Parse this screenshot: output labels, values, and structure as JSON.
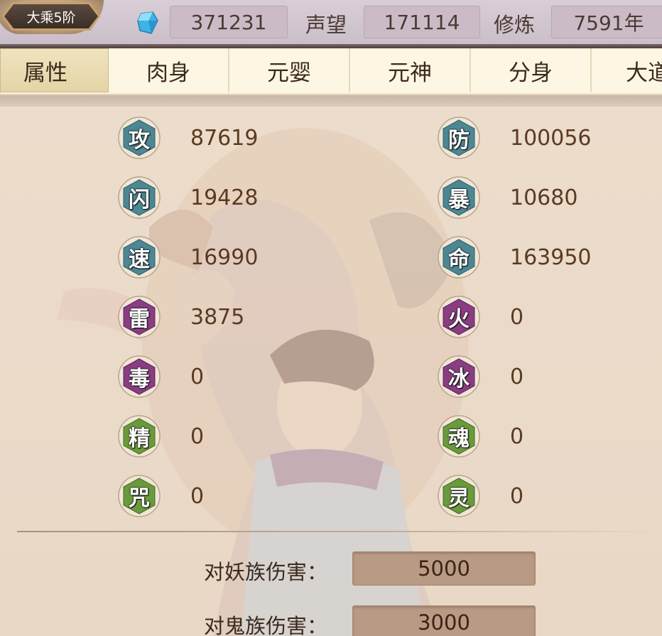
{
  "header": {
    "rank": "大乘5阶",
    "gem_icon": "blue-gem-icon",
    "gem_value": "371231",
    "prestige_label": "声望",
    "prestige_value": "171114",
    "cultivation_label": "修炼",
    "cultivation_value": "7591年"
  },
  "tabs": [
    {
      "label": "属性",
      "active": true
    },
    {
      "label": "肉身",
      "active": false
    },
    {
      "label": "元婴",
      "active": false
    },
    {
      "label": "元神",
      "active": false
    },
    {
      "label": "分身",
      "active": false
    },
    {
      "label": "大道",
      "active": false
    }
  ],
  "attributes": {
    "left": [
      {
        "glyph": "攻",
        "value": "87619",
        "color": "teal"
      },
      {
        "glyph": "闪",
        "value": "19428",
        "color": "teal"
      },
      {
        "glyph": "速",
        "value": "16990",
        "color": "teal"
      },
      {
        "glyph": "雷",
        "value": "3875",
        "color": "purple"
      },
      {
        "glyph": "毒",
        "value": "0",
        "color": "purple"
      },
      {
        "glyph": "精",
        "value": "0",
        "color": "green"
      },
      {
        "glyph": "咒",
        "value": "0",
        "color": "green"
      }
    ],
    "right": [
      {
        "glyph": "防",
        "value": "100056",
        "color": "teal"
      },
      {
        "glyph": "暴",
        "value": "10680",
        "color": "teal"
      },
      {
        "glyph": "命",
        "value": "163950",
        "color": "teal"
      },
      {
        "glyph": "火",
        "value": "0",
        "color": "purple"
      },
      {
        "glyph": "冰",
        "value": "0",
        "color": "purple"
      },
      {
        "glyph": "魂",
        "value": "0",
        "color": "green"
      },
      {
        "glyph": "灵",
        "value": "0",
        "color": "green"
      }
    ]
  },
  "damage": [
    {
      "label": "对妖族伤害：",
      "value": "5000"
    },
    {
      "label": "对鬼族伤害：",
      "value": "3000"
    }
  ],
  "colors": {
    "teal": "#4d8793",
    "purple": "#8a3d82",
    "green": "#6a9a3c"
  }
}
